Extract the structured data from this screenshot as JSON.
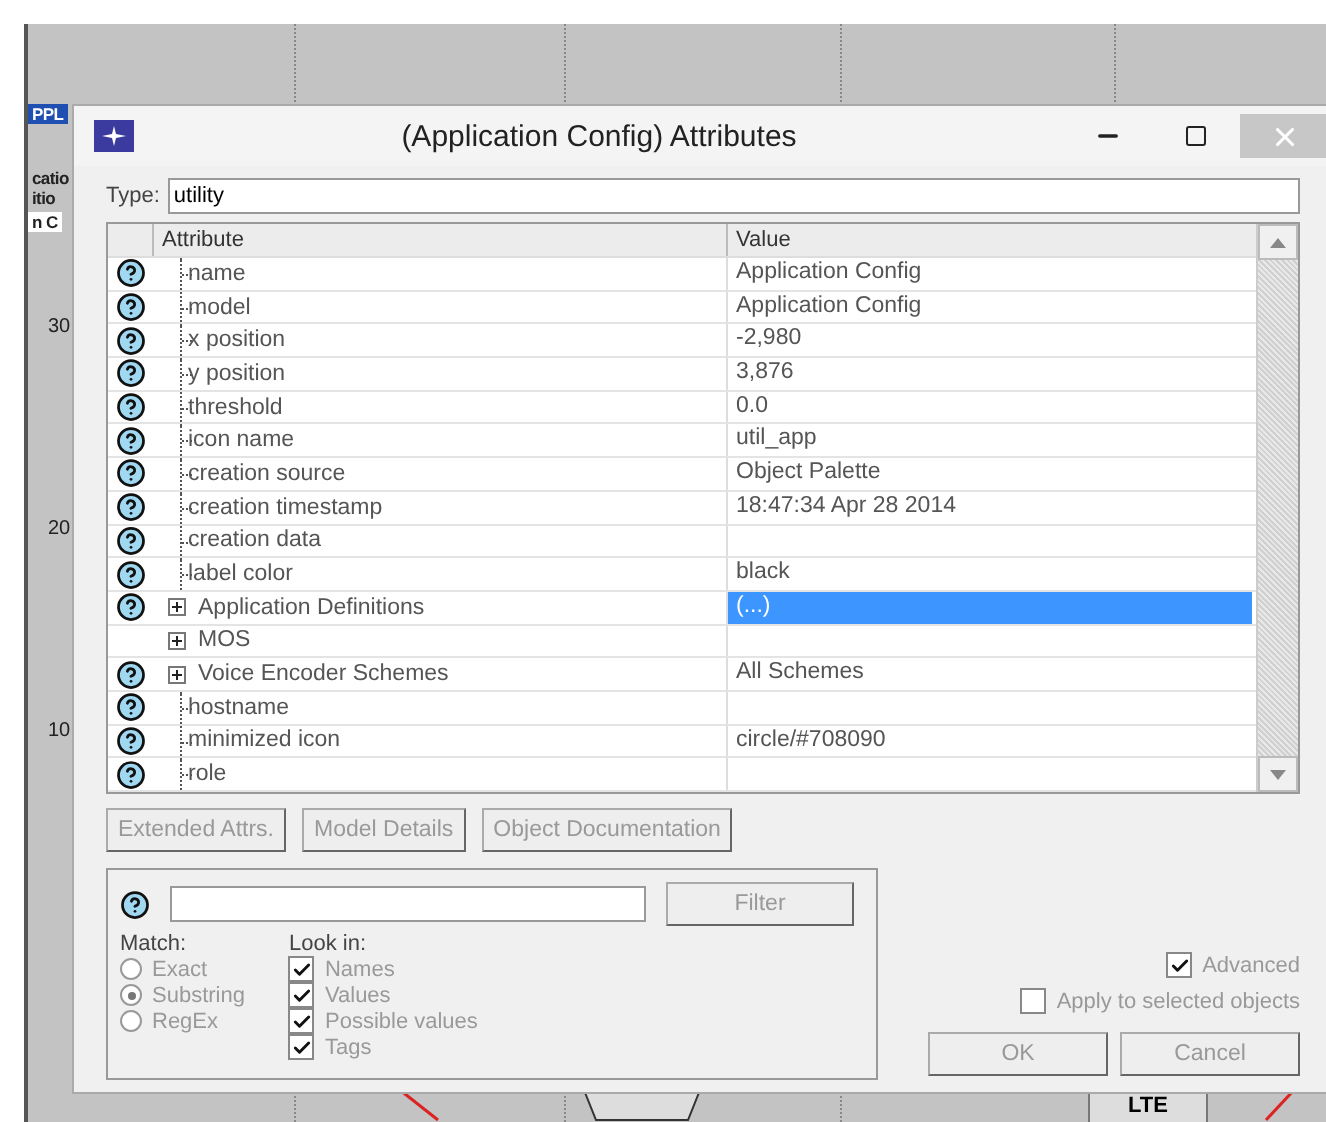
{
  "canvas": {
    "axis_labels": [
      "30",
      "20",
      "10"
    ],
    "node_fragments": [
      "PPL",
      "catio",
      "itio",
      "n C"
    ],
    "device_badge": "LTE"
  },
  "window": {
    "title": "(Application Config) Attributes"
  },
  "type_field": {
    "label": "Type:",
    "value": "utility"
  },
  "table": {
    "columns": [
      "Attribute",
      "Value"
    ],
    "rows": [
      {
        "kind": "leaf",
        "help": true,
        "name": "name",
        "value": "Application Config",
        "selected": false
      },
      {
        "kind": "leaf",
        "help": true,
        "name": "model",
        "value": "Application Config",
        "selected": false
      },
      {
        "kind": "leaf",
        "help": true,
        "name": "x position",
        "value": "-2,980",
        "selected": false
      },
      {
        "kind": "leaf",
        "help": true,
        "name": "y position",
        "value": "3,876",
        "selected": false
      },
      {
        "kind": "leaf",
        "help": true,
        "name": "threshold",
        "value": "0.0",
        "selected": false
      },
      {
        "kind": "leaf",
        "help": true,
        "name": "icon name",
        "value": "util_app",
        "selected": false
      },
      {
        "kind": "leaf",
        "help": true,
        "name": "creation source",
        "value": "Object Palette",
        "selected": false
      },
      {
        "kind": "leaf",
        "help": true,
        "name": "creation timestamp",
        "value": "18:47:34 Apr 28 2014",
        "selected": false
      },
      {
        "kind": "leaf",
        "help": true,
        "name": "creation data",
        "value": "",
        "selected": false
      },
      {
        "kind": "leaf",
        "help": true,
        "name": "label color",
        "value": "black",
        "selected": false
      },
      {
        "kind": "group",
        "help": true,
        "name": "Application Definitions",
        "value": "(...)",
        "selected": true
      },
      {
        "kind": "group",
        "help": false,
        "name": "MOS",
        "value": "",
        "selected": false
      },
      {
        "kind": "group",
        "help": true,
        "name": "Voice Encoder Schemes",
        "value": "All Schemes",
        "selected": false
      },
      {
        "kind": "leaf",
        "help": true,
        "name": "hostname",
        "value": "",
        "selected": false
      },
      {
        "kind": "leaf",
        "help": true,
        "name": "minimized icon",
        "value": "circle/#708090",
        "selected": false
      },
      {
        "kind": "leaf",
        "help": true,
        "name": "role",
        "value": "",
        "selected": false
      }
    ]
  },
  "buttons": [
    {
      "label": "Extended Attrs.",
      "disabled": true
    },
    {
      "label": "Model Details",
      "disabled": true
    },
    {
      "label": "Object Documentation",
      "disabled": true
    }
  ],
  "filter": {
    "button": {
      "label": "Filter",
      "disabled": true
    },
    "match": {
      "label": "Match:",
      "options": [
        {
          "label": "Exact",
          "selected": false
        },
        {
          "label": "Substring",
          "selected": true
        },
        {
          "label": "RegEx",
          "selected": false
        }
      ]
    },
    "look_in": {
      "label": "Look in:",
      "options": [
        {
          "label": "Names",
          "checked": true
        },
        {
          "label": "Values",
          "checked": true
        },
        {
          "label": "Possible values",
          "checked": true
        },
        {
          "label": "Tags",
          "checked": true
        }
      ]
    }
  },
  "advanced": {
    "label": "Advanced",
    "checked": true
  },
  "apply_selected": {
    "label": "Apply to selected objects",
    "checked": false
  },
  "actions": [
    {
      "label": "OK",
      "disabled": true
    },
    {
      "label": "Cancel",
      "disabled": true
    }
  ]
}
